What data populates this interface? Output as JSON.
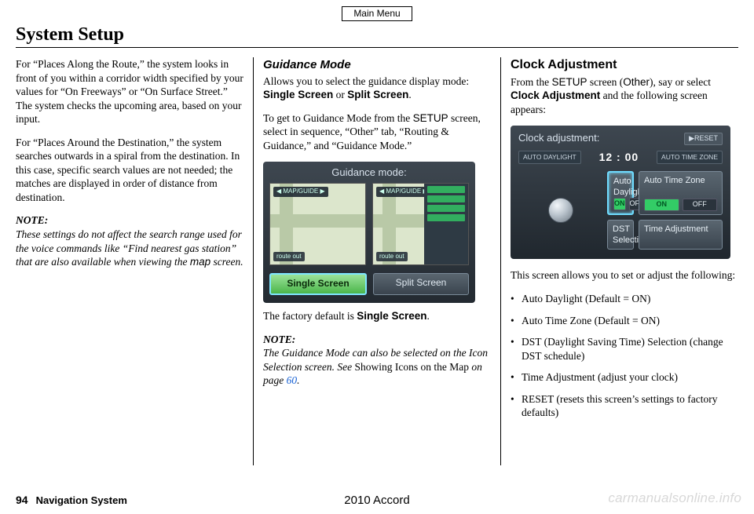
{
  "top_button": "Main Menu",
  "title": "System Setup",
  "col1": {
    "p1": "For “Places Along the Route,” the system looks in front of you within a corridor width specified by your values for “On Freeways” or “On Surface Street.” The system checks the upcoming area, based on your input.",
    "p2": "For “Places Around the Destination,” the system searches outwards in a spiral from the destination. In this case, specific search values are not needed; the matches are displayed in order of distance from destination.",
    "note_label": "NOTE:",
    "note_body_a": "These settings do not affect the search range used for the voice commands like “Find nearest gas station” that are also available when viewing the ",
    "note_map": "map",
    "note_body_b": " screen."
  },
  "col2": {
    "heading": "Guidance Mode",
    "p1a": "Allows you to select the guidance display mode: ",
    "p1b_single": "Single Screen",
    "p1c": " or ",
    "p1d_split": "Split Screen",
    "p1e": ".",
    "p2a": "To get to Guidance Mode from the ",
    "p2_setup": "SETUP",
    "p2b": " screen, select in sequence, “Other” tab, “Routing & Guidance,” and “Guidance Mode.”",
    "shot": {
      "header": "Guidance mode:",
      "mapguide": "◀ MAP/GUIDE ▶",
      "tag": "route out",
      "opt_single": "Single Screen",
      "opt_split": "Split Screen"
    },
    "p3a": "The factory default is ",
    "p3b": "Single Screen",
    "p3c": ".",
    "note_label": "NOTE:",
    "note_body_a": "The Guidance Mode can also be selected on the Icon Selection screen. See ",
    "note_ref": "Showing Icons on the Map",
    "note_body_b": " on page ",
    "note_page": "60",
    "note_body_c": "."
  },
  "col3": {
    "heading": "Clock Adjustment",
    "p1a": "From the ",
    "p1_setup": "SETUP",
    "p1b": " screen (",
    "p1_other": "Other",
    "p1c": "), say or select ",
    "p1_clock": "Clock Adjustment",
    "p1d": " and the following screen appears:",
    "shot": {
      "header": "Clock adjustment:",
      "reset": "▶RESET",
      "pill_left": "AUTO DAYLIGHT",
      "time": "12 : 00",
      "pill_right": "AUTO TIME ZONE",
      "tile1": "Auto Daylight",
      "tile2": "Auto Time Zone",
      "tile3": "DST Selection",
      "tile4": "Time Adjustment",
      "on": "ON",
      "off": "OFF"
    },
    "p2": "This screen allows you to set or adjust the following:",
    "bullets": [
      "Auto Daylight (Default = ON)",
      "Auto Time Zone (Default = ON)",
      "DST (Daylight Saving Time) Selection (change DST schedule)",
      "Time Adjustment (adjust your clock)",
      "RESET (resets this screen’s settings to factory defaults)"
    ]
  },
  "footer": {
    "page": "94",
    "section": "Navigation System",
    "model": "2010 Accord"
  },
  "watermark": "carmanualsonline.info"
}
